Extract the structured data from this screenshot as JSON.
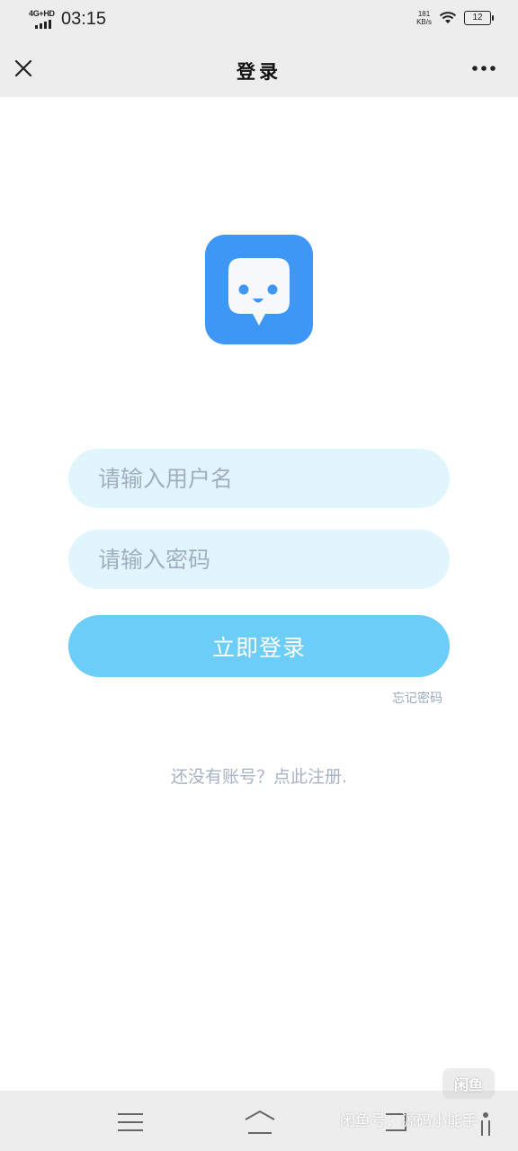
{
  "status_bar": {
    "network": "4G+HD",
    "time": "03:15",
    "speed_value": "181",
    "speed_unit": "KB/s",
    "battery": "12"
  },
  "nav": {
    "title": "登录",
    "close_icon": "close-icon",
    "more_icon": "more-dots-icon"
  },
  "logo": {
    "icon": "chat-face-logo",
    "bg_color": "#3e97f4"
  },
  "form": {
    "username_placeholder": "请输入用户名",
    "username_value": "",
    "password_placeholder": "请输入密码",
    "password_value": "",
    "login_label": "立即登录",
    "forgot_label": "忘记密码",
    "register_label": "还没有账号？点此注册."
  },
  "colors": {
    "field_bg": "#e1f5fd",
    "button_bg": "#6ccdf6",
    "bar_bg": "#ededed"
  },
  "watermark": {
    "text": "闲鱼号：源码小能手",
    "badge": "闲鱼"
  }
}
